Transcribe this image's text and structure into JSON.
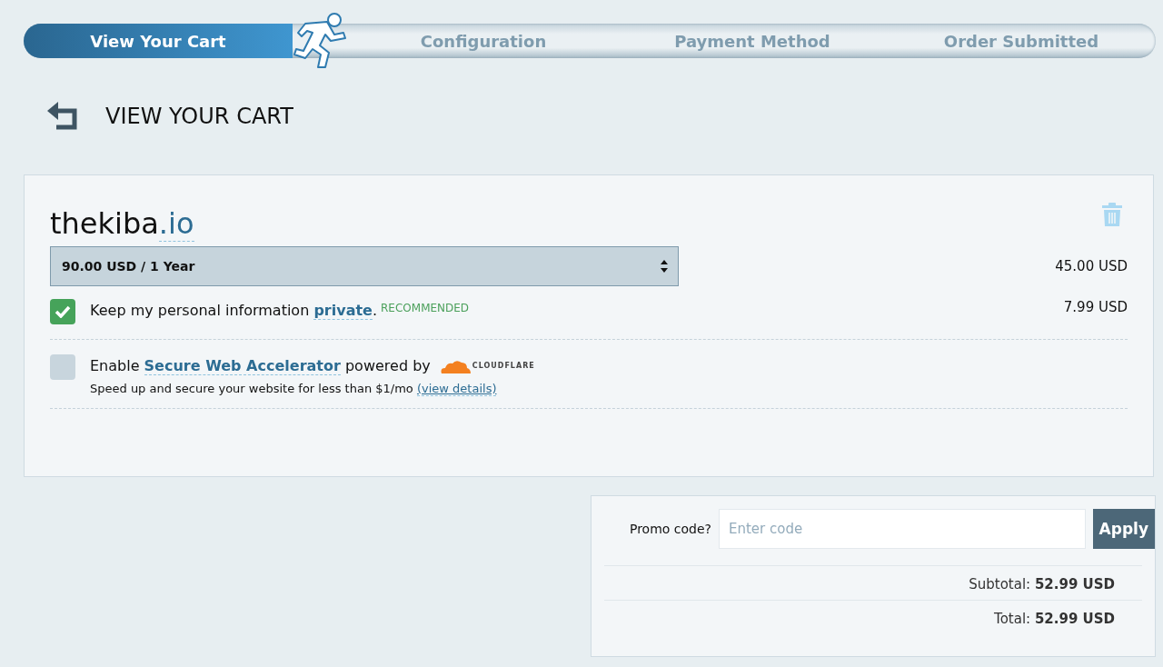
{
  "steps": [
    {
      "label": "View Your Cart",
      "selected": true
    },
    {
      "label": "Configuration",
      "selected": false
    },
    {
      "label": "Payment Method",
      "selected": false
    },
    {
      "label": "Order Submitted",
      "selected": false
    }
  ],
  "page_title": "VIEW YOUR CART",
  "cart_item": {
    "domain": "thekiba",
    "tld": ".io",
    "period": "90.00 USD / 1 Year",
    "price": "45.00 USD",
    "options": [
      {
        "checked": true,
        "before": "Keep my personal information ",
        "link": "private",
        "after": ".",
        "badge": "RECOMMENDED",
        "price": "7.99 USD"
      },
      {
        "checked": false,
        "before": "Enable ",
        "link": "Secure Web Accelerator",
        "after": " powered by",
        "logo": "CLOUDFLARE",
        "note": "Speed up and secure your website for less than $1/mo ",
        "note_link": "(view details)"
      }
    ]
  },
  "summary": {
    "promo_label": "Promo code?",
    "promo_placeholder": "Enter code",
    "apply": "Apply",
    "lines": [
      {
        "label": "Subtotal: ",
        "value": "52.99 USD"
      },
      {
        "label": "Total: ",
        "value": "52.99 USD"
      }
    ]
  }
}
